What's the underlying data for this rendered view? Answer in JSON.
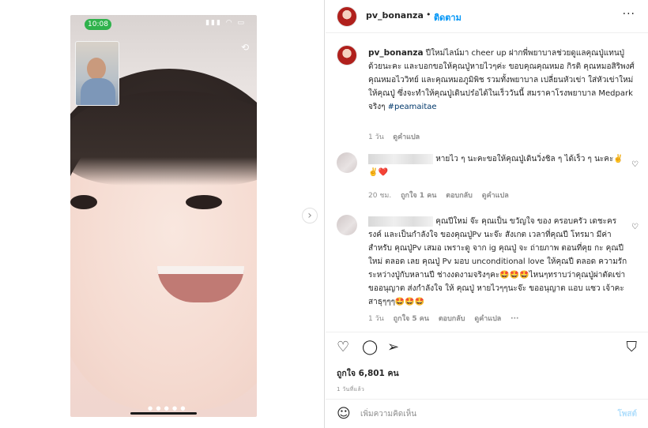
{
  "media": {
    "phone_time": "10:08",
    "phone_status_icons": "▮▮▮ ◠ ▭",
    "next_icon": "chevron-right-icon",
    "next_glyph": "›",
    "carousel_dots": "● ● ● ● ●"
  },
  "header": {
    "username": "pv_bonanza",
    "separator": "•",
    "follow_label": "ติดตาม",
    "more_icon": "more-dots-icon",
    "more_glyph": "···"
  },
  "caption": {
    "username": "pv_bonanza",
    "text": "ปีใหม่ไลน์มา cheer up ฝากพี่พยาบาลช่วยดูแลคุณปู่แทนปู่ด้วยนะคะ และบอกขอให้คุณปู่หายไวๆค่ะ ขอบคุณคุณหมอ กิรติ คุณหมอสิริพงศ์ คุณหมอไววิทย์ และคุณหมอภูมิพิช รวมทั้งพยาบาล เปลี่ยนหัวเข่า ใส่หัวเข่าใหม่ให้คุณปู่ ซึ่งจะทำให้คุณปู่เดินปร๋อได้ในเร็ววันนี้ สมราคาโรงพยาบาล Medpark จริงๆ",
    "hashtag": "#peamaitae",
    "time": "1 วัน",
    "translate": "ดูคำแปล"
  },
  "comments": [
    {
      "text": "หายไว ๆ นะคะขอให้คุณปู่เดินวิ่งชิล ๆ ได้เร็ว ๆ นะคะ✌️✌️❤️",
      "time": "20 ชม.",
      "likes": "ถูกใจ 1 คน",
      "reply": "ตอบกลับ",
      "translate": "ดูคำแปล",
      "like_icon": "heart-outline-icon"
    },
    {
      "text": "คุณปีใหม่ จ๊ะ คุณเป็น ขวัญใจ ของ ครอบครัว เดชะครรงค์ และเป็นกำลังใจ ของคุณปู่Pv นะจ๊ะ สังเกต เวลาที่คุณปี โทรมา มีค่าสำหรับ คุณปู่Pv เสมอ เพราะดู จาก ig คุณปู่ จะ ถ่ายภาพ ตอนที่คุย กะ คุณปีใหม่ ตลอด เลย คุณปู่ Pv มอบ unconditional love ให้คุณปี ตลอด ความรักระหว่างปู่กับหลานปี ช่างงดงามจริงๆคะ🤩🤩🤩ไหนๆทราบว่าคุณปู่ผ่าตัดเข่า ขออนุญาต ส่งกำลังใจ ให้ คุณปู่ หายไวๆๆนะจ๊ะ ขออนุญาต แอบ แซว เจ้าคะ สาธุๆๆๆ🤩🤩🤩",
      "time": "1 วัน",
      "likes": "ถูกใจ 5 คน",
      "reply": "ตอบกลับ",
      "translate": "ดูคำแปล",
      "more": "···",
      "like_icon": "heart-outline-icon"
    }
  ],
  "actions": {
    "like_icon": "heart-outline-icon",
    "comment_icon": "comment-bubble-icon",
    "share_icon": "paper-plane-icon",
    "save_icon": "bookmark-icon",
    "like_glyph": "♡",
    "comment_glyph": "◯",
    "share_glyph": "➢",
    "save_glyph": "⛉"
  },
  "likes_count": "ถูกใจ 6,801 คน",
  "posted_ago": "1 วันที่แล้ว",
  "add_comment": {
    "emoji_icon": "smiley-icon",
    "emoji_glyph": "☺",
    "placeholder": "เพิ่มความคิดเห็น",
    "post_label": "โพสต์"
  },
  "colors": {
    "accent": "#0095f6",
    "post_disabled": "#b2dffc",
    "secondary_text": "#8e8e8e",
    "hashtag": "#00376b"
  }
}
